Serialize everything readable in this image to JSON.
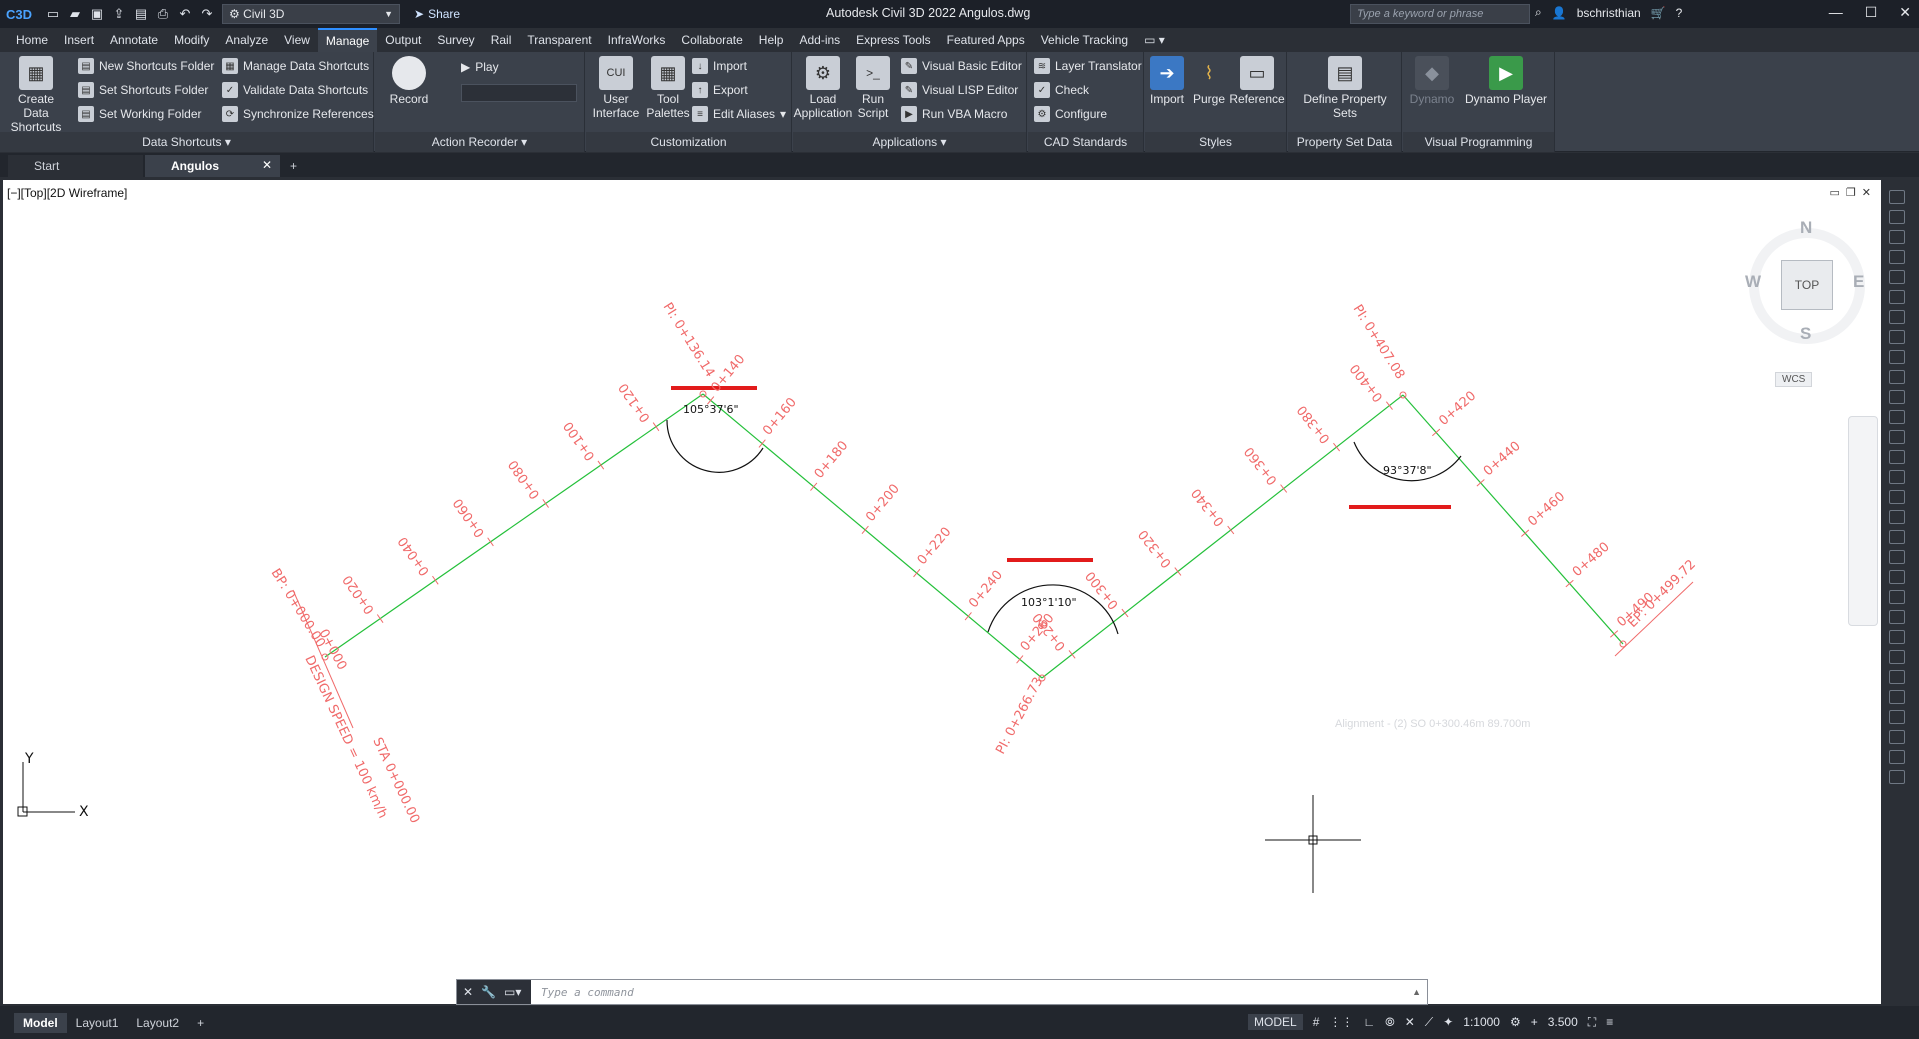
{
  "titlebar": {
    "logo": "C3D",
    "workspace": "Civil 3D",
    "share": "Share",
    "title": "Autodesk Civil 3D 2022   Angulos.dwg",
    "search_placeholder": "Type a keyword or phrase",
    "user": "bschristhian"
  },
  "menu": [
    "Home",
    "Insert",
    "Annotate",
    "Modify",
    "Analyze",
    "View",
    "Manage",
    "Output",
    "Survey",
    "Rail",
    "Transparent",
    "InfraWorks",
    "Collaborate",
    "Help",
    "Add-ins",
    "Express Tools",
    "Featured Apps",
    "Vehicle Tracking"
  ],
  "active_menu": "Manage",
  "ribbon": {
    "data_shortcuts": {
      "title": "Data Shortcuts",
      "create": "Create Data Shortcuts",
      "new_folder": "New Shortcuts Folder",
      "set_folder": "Set Shortcuts Folder",
      "set_working": "Set Working Folder",
      "manage": "Manage Data Shortcuts",
      "validate": "Validate Data Shortcuts",
      "sync": "Synchronize References"
    },
    "action_recorder": {
      "title": "Action Recorder",
      "record": "Record",
      "play": "Play"
    },
    "customization": {
      "title": "Customization",
      "user_interface": "User Interface",
      "tool_palettes": "Tool Palettes",
      "import": "Import",
      "export": "Export",
      "edit_aliases": "Edit Aliases"
    },
    "applications": {
      "title": "Applications",
      "load": "Load Application",
      "run_script": "Run Script",
      "vba_editor": "Visual Basic Editor",
      "lisp_editor": "Visual LISP Editor",
      "vba_macro": "Run VBA Macro"
    },
    "cad_standards": {
      "title": "CAD Standards",
      "layer_translator": "Layer Translator",
      "check": "Check",
      "configure": "Configure"
    },
    "styles": {
      "title": "Styles",
      "import": "Import",
      "purge": "Purge",
      "reference": "Reference"
    },
    "property_sets": {
      "title": "Property Set Data",
      "define": "Define Property Sets"
    },
    "visual_programming": {
      "title": "Visual Programming",
      "dynamo": "Dynamo",
      "player": "Dynamo Player"
    }
  },
  "doc_tabs": {
    "start": "Start",
    "active": "Angulos"
  },
  "viewport": {
    "label": "[−][Top][2D Wireframe]",
    "compass": {
      "n": "N",
      "s": "S",
      "e": "E",
      "w": "W",
      "face": "TOP"
    },
    "wcs": "WCS",
    "tooltip": "Alignment - (2)   SO   0+300.46m   89.700m"
  },
  "alignment": {
    "stations": [
      "0+020",
      "0+040",
      "0+060",
      "0+080",
      "0+100",
      "0+120",
      "0+140",
      "0+160",
      "0+180",
      "0+200",
      "0+220",
      "0+240",
      "0+260",
      "0+280",
      "0+300",
      "0+320",
      "0+340",
      "0+360",
      "0+380",
      "0+400",
      "0+420",
      "0+440",
      "0+460",
      "0+480",
      "0+490"
    ],
    "pi_labels": [
      "PI: 0+136.14",
      "PI: 0+266.73",
      "PI: 0+407.08"
    ],
    "angles": [
      "105°37'6\"",
      "103°1'10\"",
      "93°37'8\""
    ],
    "begin_label": "BP: 0+000.00",
    "end_label": "EP: 0+499.72",
    "design_speed": "DESIGN SPEED = 100 km/h",
    "sta_label": "STA 0+000.00",
    "start_station": "0+000"
  },
  "ucs": {
    "x": "X",
    "y": "Y"
  },
  "command_line": {
    "placeholder": "Type a command"
  },
  "status": {
    "layouts": [
      "Model",
      "Layout1",
      "Layout2"
    ],
    "model": "MODEL",
    "scale": "1:1000",
    "annot": "3.500"
  },
  "colors": {
    "station": "#f06a6a",
    "alignment": "#24c03a",
    "highlight": "#e21b1b",
    "accent": "#2f8fff"
  }
}
